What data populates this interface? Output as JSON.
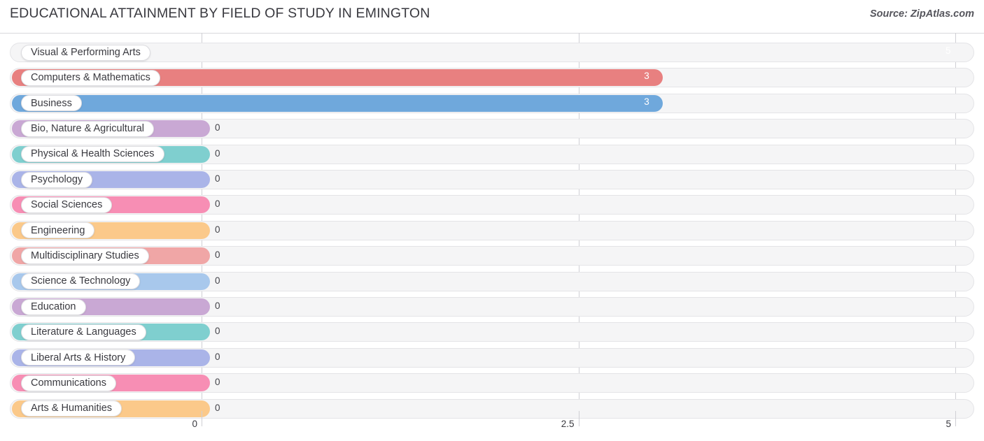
{
  "header": {
    "title": "EDUCATIONAL ATTAINMENT BY FIELD OF STUDY IN EMINGTON",
    "source": "Source: ZipAtlas.com"
  },
  "chart_data": {
    "type": "bar",
    "orientation": "horizontal",
    "title": "EDUCATIONAL ATTAINMENT BY FIELD OF STUDY IN EMINGTON",
    "xlabel": "",
    "ylabel": "",
    "xlim": [
      0,
      5
    ],
    "grid": true,
    "legend": "none",
    "xticks": [
      "0",
      "2.5",
      "5"
    ],
    "xtick_values": [
      0,
      2.5,
      5
    ],
    "categories": [
      "Visual & Performing Arts",
      "Computers & Mathematics",
      "Business",
      "Bio, Nature & Agricultural",
      "Physical & Health Sciences",
      "Psychology",
      "Social Sciences",
      "Engineering",
      "Multidisciplinary Studies",
      "Science & Technology",
      "Education",
      "Literature & Languages",
      "Liberal Arts & History",
      "Communications",
      "Arts & Humanities"
    ],
    "values": [
      5,
      3,
      3,
      0,
      0,
      0,
      0,
      0,
      0,
      0,
      0,
      0,
      0,
      0,
      0
    ],
    "value_labels": [
      "5",
      "3",
      "3",
      "0",
      "0",
      "0",
      "0",
      "0",
      "0",
      "0",
      "0",
      "0",
      "0",
      "0",
      "0"
    ],
    "colors": [
      "#f5a council",
      "#e88080",
      "#6fa8dc",
      "#c9a8d4",
      "#7fcfcf",
      "#aab4e8",
      "#f78eb4",
      "#fbc98a",
      "#f0a6a6",
      "#a8c8ec",
      "#c9a8d4",
      "#7fcfcf",
      "#aab4e8",
      "#f78eb4",
      "#fbc98a"
    ]
  },
  "bars": [
    {
      "label": "Visual & Performing Arts",
      "value": 5,
      "value_label": "5",
      "color": "#f5a royal"
    },
    {
      "label": "Computers & Mathematics",
      "value": 3,
      "value_label": "3",
      "color": "#e88080"
    },
    {
      "label": "Business",
      "value": 3,
      "value_label": "3",
      "color": "#6fa8dc"
    },
    {
      "label": "Bio, Nature & Agricultural",
      "value": 0,
      "value_label": "0",
      "color": "#c9a8d4"
    },
    {
      "label": "Physical & Health Sciences",
      "value": 0,
      "value_label": "0",
      "color": "#7fcfcf"
    },
    {
      "label": "Psychology",
      "value": 0,
      "value_label": "0",
      "color": "#aab4e8"
    },
    {
      "label": "Social Sciences",
      "value": 0,
      "value_label": "0",
      "color": "#f78eb4"
    },
    {
      "label": "Engineering",
      "value": 0,
      "value_label": "0",
      "color": "#fbc98a"
    },
    {
      "label": "Multidisciplinary Studies",
      "value": 0,
      "value_label": "0",
      "color": "#f0a6a6"
    },
    {
      "label": "Science & Technology",
      "value": 0,
      "value_label": "0",
      "color": "#a8c8ec"
    },
    {
      "label": "Education",
      "value": 0,
      "value_label": "0",
      "color": "#c9a8d4"
    },
    {
      "label": "Literature & Languages",
      "value": 0,
      "value_label": "0",
      "color": "#7fcfcf"
    },
    {
      "label": "Liberal Arts & History",
      "value": 0,
      "value_label": "0",
      "color": "#aab4e8"
    },
    {
      "label": "Communications",
      "value": 0,
      "value_label": "0",
      "color": "#f78eb4"
    },
    {
      "label": "Arts & Humanities",
      "value": 0,
      "value_label": "0",
      "color": "#fbc98a"
    }
  ],
  "axis": {
    "ticks": [
      {
        "label": "0",
        "value": 0
      },
      {
        "label": "2.5",
        "value": 2.5
      },
      {
        "label": "5",
        "value": 5
      }
    ]
  }
}
